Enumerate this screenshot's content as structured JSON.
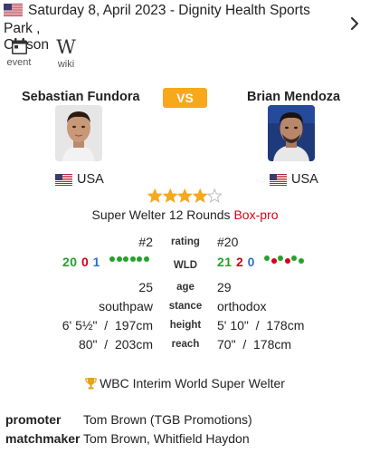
{
  "event": {
    "date_venue": "Saturday 8, April 2023  -  Dignity Health Sports Park ,",
    "city": "Carson",
    "links": [
      {
        "label": "event",
        "icon": "calendar-icon"
      },
      {
        "label": "wiki",
        "icon": "wikipedia-icon"
      }
    ]
  },
  "vs_label": "VS",
  "fighters": {
    "left": {
      "name": "Sebastian Fundora",
      "country": "USA"
    },
    "right": {
      "name": "Brian Mendoza",
      "country": "USA"
    }
  },
  "rating_stars": {
    "filled": 4,
    "total": 5
  },
  "bout": {
    "division": "Super Welter 12 Rounds",
    "type": "Box-pro"
  },
  "labels": {
    "rating": "rating",
    "wld": "WLD",
    "age": "age",
    "stance": "stance",
    "height": "height",
    "reach": "reach"
  },
  "stats": {
    "left": {
      "rating": "#2",
      "wins": "20",
      "losses": "0",
      "draws": "1",
      "recent": [
        "W",
        "W",
        "W",
        "W",
        "W",
        "W"
      ],
      "age": "25",
      "stance": "southpaw",
      "height": "6' 5½\"  /  197cm",
      "reach": "80\"  /  203cm"
    },
    "right": {
      "rating": "#20",
      "wins": "21",
      "losses": "2",
      "draws": "0",
      "recent": [
        "W",
        "L",
        "W",
        "L",
        "W",
        "W"
      ],
      "age": "29",
      "stance": "orthodox",
      "height": "5' 10\"  /  178cm",
      "reach": "70\"  /  178cm"
    }
  },
  "title": "WBC Interim World Super Welter",
  "officials": {
    "promoter_label": "promoter",
    "promoter": "Tom Brown (TGB Promotions)",
    "matchmaker_label": "matchmaker",
    "matchmaker": "Tom Brown, Whitfield Haydon"
  },
  "colors": {
    "accent": "#f7a81b",
    "win": "#26a12c",
    "loss": "#d0021b",
    "draw": "#2a6fd6"
  }
}
